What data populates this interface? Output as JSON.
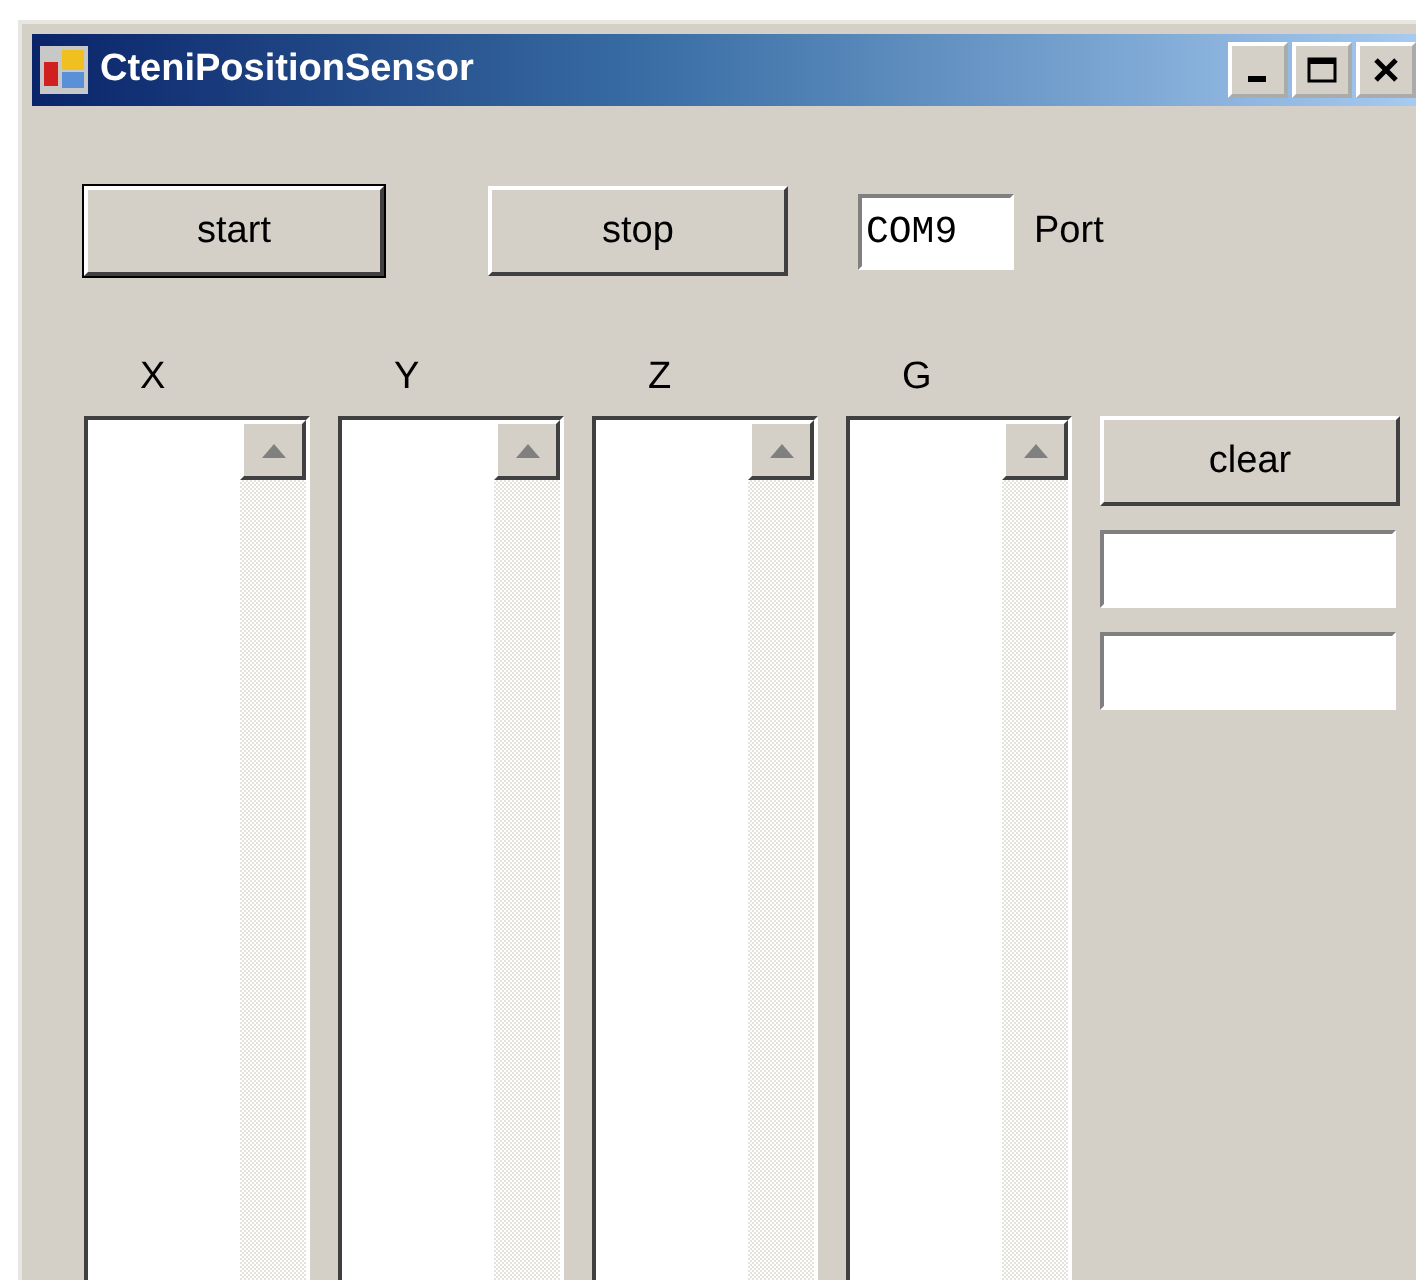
{
  "window": {
    "title": "CteniPositionSensor"
  },
  "toolbar": {
    "start_button": "start",
    "stop_button": "stop",
    "port_field": {
      "value": "COM9"
    },
    "port_label": "Port"
  },
  "columns": [
    {
      "label": "X"
    },
    {
      "label": "Y"
    },
    {
      "label": "Z"
    },
    {
      "label": "G"
    }
  ],
  "side_panel": {
    "clear_button": "clear",
    "fields": [
      {
        "kind": "textbox"
      },
      {
        "kind": "textbox"
      }
    ]
  }
}
